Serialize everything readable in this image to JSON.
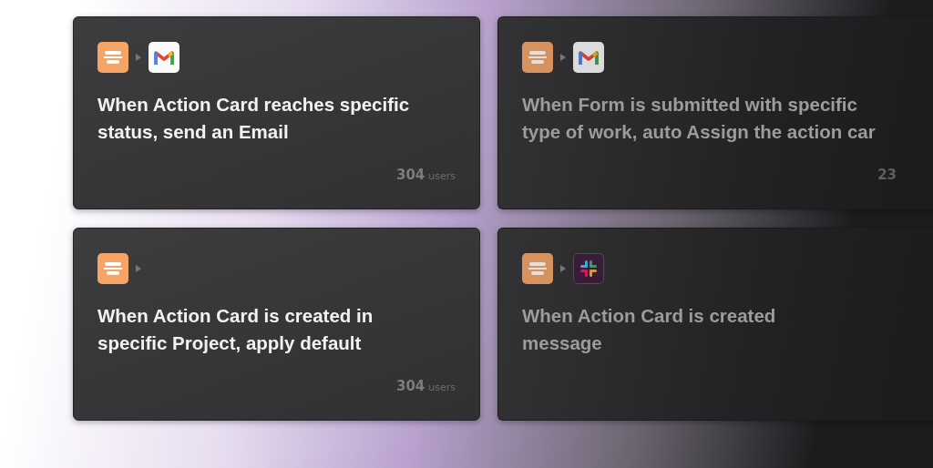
{
  "cards": [
    {
      "apps": [
        {
          "kind": "app"
        },
        {
          "kind": "mail"
        }
      ],
      "lines": [
        "When Action Card reaches specific",
        "status, send an Email"
      ],
      "count": "304",
      "count_label": "users"
    },
    {
      "apps": [
        {
          "kind": "app"
        },
        {
          "kind": "mail"
        }
      ],
      "lines": [
        "When Form is submitted with specific",
        "type of work, auto Assign the action car"
      ],
      "count": "23"
    },
    {
      "apps": [
        {
          "kind": "app"
        }
      ],
      "lines": [
        "When Action Card is created in",
        "specific Project, apply default"
      ],
      "count": "304",
      "count_label": "users"
    },
    {
      "apps": [
        {
          "kind": "app"
        },
        {
          "kind": "chat"
        }
      ],
      "lines": [
        "When Action Card is created",
        "message"
      ]
    }
  ]
}
